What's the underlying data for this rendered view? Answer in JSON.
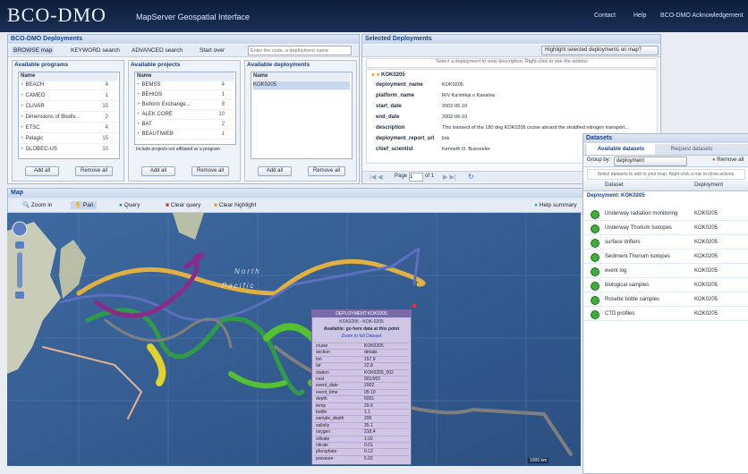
{
  "header": {
    "logo": "BCO-DMO",
    "subtitle": "MapServer Geospatial Interface",
    "links": [
      "Contact",
      "Help",
      "BCO-DMO Acknowledgement"
    ]
  },
  "search_panel": {
    "title": "BCO-DMO Deployments",
    "tabs": [
      "BROWSE map",
      "KEYWORD search",
      "ADVANCED search",
      "Start over"
    ],
    "search_placeholder": "Enter the code, a deployment name",
    "programs_title": "Available programs",
    "projects_title": "Available projects",
    "deployments_title": "Available deployments",
    "col_name": "Name",
    "programs": [
      {
        "name": "BEACH",
        "count": "4"
      },
      {
        "name": "CAMEO",
        "count": "1"
      },
      {
        "name": "CLIVAR",
        "count": "15"
      },
      {
        "name": "Dimensions of Biodiv...",
        "count": "2"
      },
      {
        "name": "ETSC",
        "count": "4"
      },
      {
        "name": "Pelagic",
        "count": "15"
      },
      {
        "name": "GLOBEC-US",
        "count": "10"
      }
    ],
    "projects": [
      {
        "name": "BEMSS",
        "count": "4"
      },
      {
        "name": "BEHIOS",
        "count": "1"
      },
      {
        "name": "Bioform Exchange...",
        "count": "8"
      },
      {
        "name": "ALEK CORE",
        "count": "10"
      },
      {
        "name": "BAT",
        "count": "2"
      },
      {
        "name": "BEAUTIWEB",
        "count": "1"
      }
    ],
    "deployments": [
      "KOK0205"
    ],
    "checkbox_label": "Include projects not affiliated w/ a program",
    "add_all": "Add all",
    "remove_all": "Remove all"
  },
  "selected_panel": {
    "title": "Selected Deployments",
    "dropdown": "Highlight selected deployments on map?",
    "hint": "Select a deployment to view description. Right-click to see the actions",
    "deployment": "KOK0205",
    "fields": [
      {
        "k": "deployment_name",
        "v": "KOK0205"
      },
      {
        "k": "platform_name",
        "v": "R/V Ka'imikai o Kanaloa"
      },
      {
        "k": "start_date",
        "v": "2002-05-10"
      },
      {
        "k": "end_date",
        "v": "2002-06-10"
      },
      {
        "k": "description",
        "v": "This transect of the 180 deg KOK0205 cruise aboard the stratified nitrogen transport..."
      },
      {
        "k": "deployment_report_url",
        "v": "link"
      },
      {
        "k": "chief_scientist",
        "v": "Kenneth O. Buesseler"
      }
    ],
    "page_label": "Page",
    "page_value": "1",
    "page_of": "of 1"
  },
  "map_panel": {
    "title": "Map",
    "tools": [
      "Zoom in",
      "Pan",
      "Query",
      "Clear query",
      "Clear highlight"
    ],
    "help_label": "Help summary",
    "labels": [
      {
        "t": "North",
        "cls": "ocean"
      },
      {
        "t": "Pacific",
        "cls": "ocean"
      }
    ],
    "scale": "1000 km",
    "popup": {
      "header": "DEPLOYMENT KOK0205",
      "line1": "KOK0205 - KOK-0205",
      "line2": "Available: go here data at this point",
      "line3": "Zoom to full Dataset",
      "rows": [
        {
          "k": "cruise",
          "v": "KOK0205"
        },
        {
          "k": "section",
          "v": "details"
        },
        {
          "k": "lon",
          "v": "157.9"
        },
        {
          "k": "lat",
          "v": "22.8"
        },
        {
          "k": "station",
          "v": "KOK0205_002"
        },
        {
          "k": "cast",
          "v": "001/002"
        },
        {
          "k": "event_date",
          "v": "2002"
        },
        {
          "k": "event_time",
          "v": "05:10"
        },
        {
          "k": "depth",
          "v": "5001"
        },
        {
          "k": "temp",
          "v": "29.6"
        },
        {
          "k": "bottle",
          "v": "1.1"
        },
        {
          "k": "sample_depth",
          "v": "200"
        },
        {
          "k": "salinity",
          "v": "35.1"
        },
        {
          "k": "oxygen",
          "v": "218.4"
        },
        {
          "k": "silicate",
          "v": "1.02"
        },
        {
          "k": "nitrate",
          "v": "0.01"
        },
        {
          "k": "phosphate",
          "v": "0.12"
        },
        {
          "k": "pressure",
          "v": "5.02"
        }
      ]
    }
  },
  "datasets_panel": {
    "title": "Datasets",
    "tabs": [
      "Available datasets",
      "Request datasets"
    ],
    "group_label": "Group by:",
    "group_value": "deployment",
    "remove_label": "Remove all",
    "hint": "Select datasets to add to your map. Right-click a row to show actions.",
    "col_dataset": "Dataset",
    "col_deployment": "Deployment",
    "group_row": "Deployment: KOK0205",
    "datasets": [
      {
        "name": "Underway radiation monitoring",
        "dep": "KOK0205"
      },
      {
        "name": "Underway Thorium Isotopes",
        "dep": "KOK0205"
      },
      {
        "name": "surface drifters",
        "dep": "KOK0205"
      },
      {
        "name": "Sediment Thorium isotopes",
        "dep": "KOK0205"
      },
      {
        "name": "event log",
        "dep": "KOK0205"
      },
      {
        "name": "biological samples",
        "dep": "KOK0205"
      },
      {
        "name": "Rosette bottle samples",
        "dep": "KOK0205"
      },
      {
        "name": "CTD profiles",
        "dep": "KOK0205"
      }
    ]
  },
  "colors": {
    "header_bg": "#0d1e3a",
    "ocean": "#365f94",
    "land": "#c9cdb8",
    "popup": "#cfc6e6",
    "dataset_icon": "#3dad3d"
  }
}
